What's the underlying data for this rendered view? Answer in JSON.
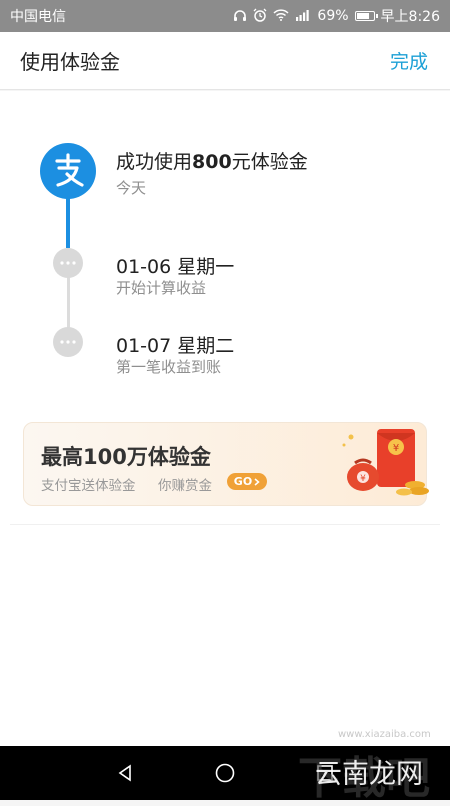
{
  "status_bar": {
    "carrier": "中国电信",
    "battery": "69%",
    "time": "早上8:26"
  },
  "header": {
    "title": "使用体验金",
    "done_label": "完成"
  },
  "timeline": {
    "step1": {
      "title_prefix": "成功使用",
      "title_amount": "800",
      "title_suffix": "元体验金",
      "sub": "今天"
    },
    "step2": {
      "title": "01-06 星期一",
      "sub": "开始计算收益"
    },
    "step3": {
      "title": "01-07 星期二",
      "sub": "第一笔收益到账"
    }
  },
  "banner": {
    "title": "最高100万体验金",
    "sub1": "支付宝送体验金",
    "sub2": "你赚赏金",
    "go_label": "GO",
    "packet_symbol": "¥"
  },
  "watermark": {
    "text": "云南龙网",
    "bg_text": "下载吧",
    "url": "www.xiazaiba.com"
  },
  "colors": {
    "accent": "#1ca0d6",
    "alipay_blue": "#1c8fe1",
    "go_orange": "#f0a137",
    "packet_red": "#e8402a"
  }
}
